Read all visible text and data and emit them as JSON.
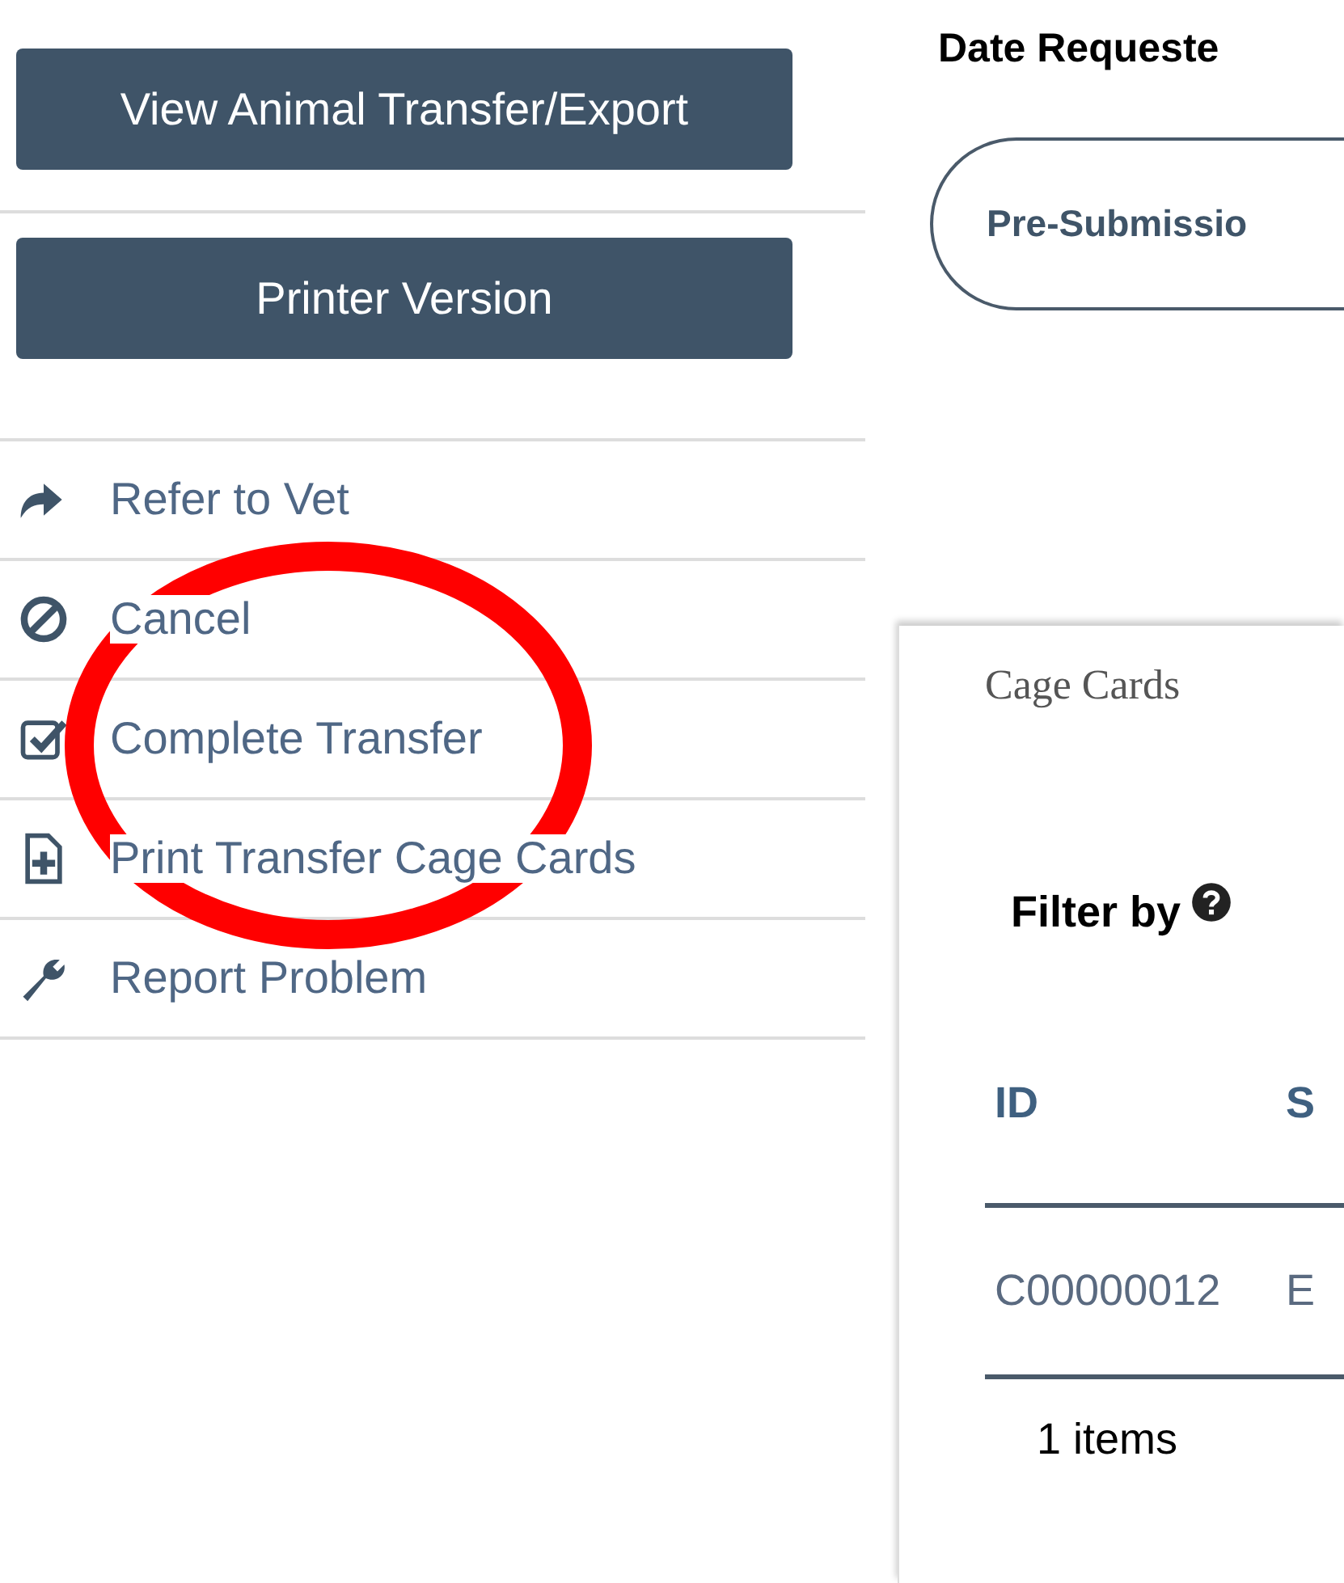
{
  "sidebar": {
    "buttons": [
      {
        "label": "View Animal Transfer/Export"
      },
      {
        "label": "Printer Version"
      }
    ],
    "actions": [
      {
        "kind": "share",
        "label": "Refer to Vet"
      },
      {
        "kind": "ban",
        "label": "Cancel"
      },
      {
        "kind": "check",
        "label": "Complete Transfer"
      },
      {
        "kind": "add-file",
        "label": "Print Transfer Cage Cards"
      },
      {
        "kind": "wrench",
        "label": "Report Problem"
      }
    ]
  },
  "main": {
    "field_label": "Date Requeste",
    "status_pill": "Pre-Submissio",
    "card": {
      "title": "Cage Cards",
      "filter_label": "Filter by",
      "table": {
        "columns": [
          "ID",
          "S"
        ],
        "rows": [
          [
            "C00000012",
            "E"
          ]
        ]
      },
      "footer": "1 items"
    }
  }
}
